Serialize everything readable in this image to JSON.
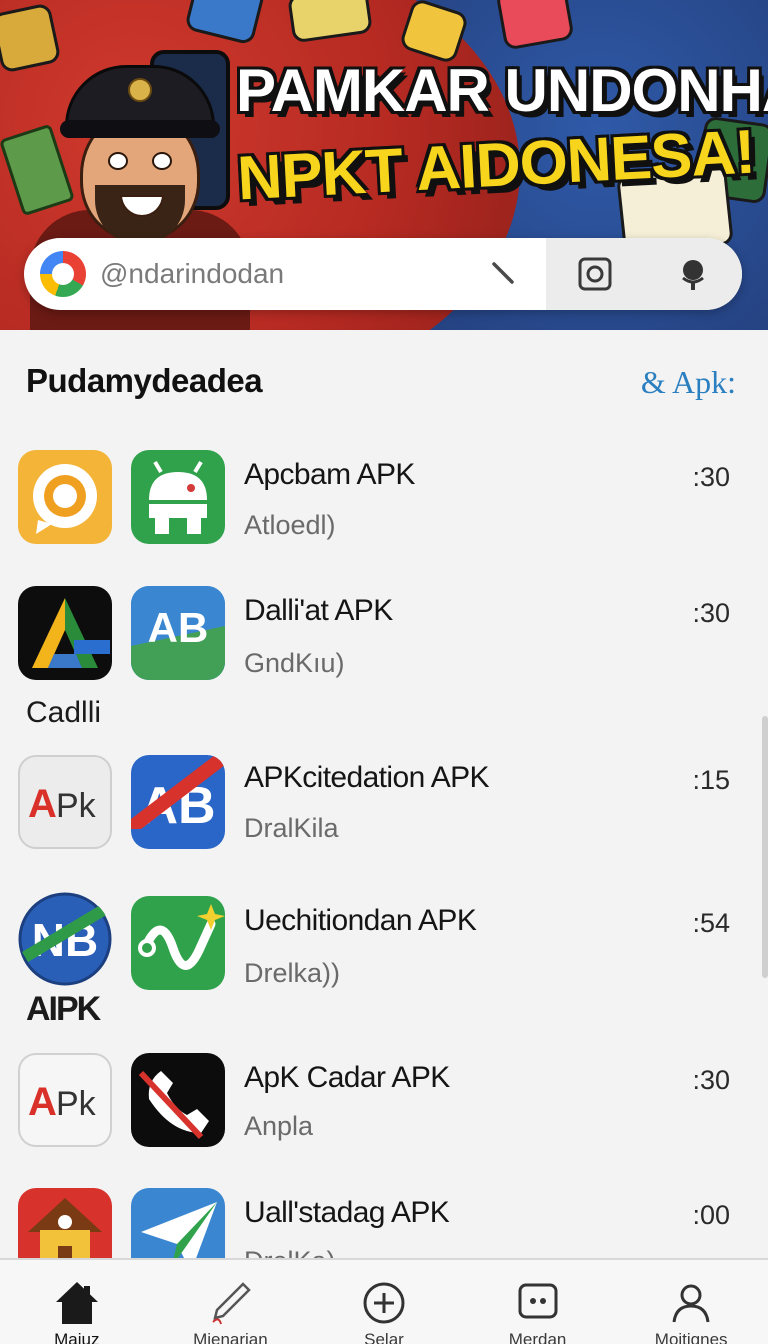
{
  "banner": {
    "headline_line1": "PAMKAR UNDONHAN",
    "headline_line2": "NPKT AIDONESA!"
  },
  "search": {
    "placeholder": "@ndarindodan"
  },
  "section": {
    "title": "Pudamydeadea",
    "link": "& Apk:"
  },
  "apps": [
    {
      "name": "Apcbam APK",
      "sub": "Atloedl)",
      "time": ":30",
      "left_icon": "chat-bubble-icon",
      "right_icon": "android-icon",
      "under_label": ""
    },
    {
      "name": "Dalli'at APK",
      "sub": "GndKıu)",
      "time": ":30",
      "left_icon": "triangle-logo-icon",
      "right_icon": "ab-logo-icon",
      "under_label": "Cadlli"
    },
    {
      "name": "APKcitedation APK",
      "sub": "DralKila",
      "time": ":15",
      "left_icon": "apk-logo-icon",
      "right_icon": "ab-banner-logo-icon",
      "under_label": ""
    },
    {
      "name": "Uechitiondan APK",
      "sub": "Drelka))",
      "time": ":54",
      "left_icon": "nb-badge-icon",
      "right_icon": "wave-sparkle-icon",
      "under_label": "AIPK"
    },
    {
      "name": "ApK Cadar APK",
      "sub": "Anpla",
      "time": ":30",
      "left_icon": "apk-logo-icon",
      "right_icon": "phone-icon",
      "under_label": ""
    },
    {
      "name": "Uall'stadag APK",
      "sub": "DrelKa)",
      "time": ":00",
      "left_icon": "house-icon",
      "right_icon": "paper-plane-icon",
      "under_label": ""
    }
  ],
  "bottom_nav": [
    {
      "label": "Maiuz",
      "icon": "home-icon",
      "active": true
    },
    {
      "label": "Mienarian",
      "icon": "pen-icon",
      "active": false
    },
    {
      "label": "Selar",
      "icon": "plus-circle-icon",
      "active": false
    },
    {
      "label": "Merdan",
      "icon": "chat-square-icon",
      "active": false
    },
    {
      "label": "Moitignes",
      "icon": "person-icon",
      "active": false
    }
  ]
}
